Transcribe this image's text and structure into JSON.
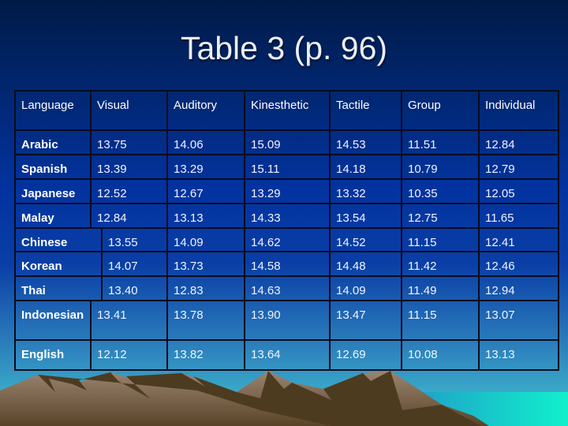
{
  "title": "Table 3 (p. 96)",
  "table": {
    "headers": [
      "Language",
      "Visual",
      "Auditory",
      "Kinesthetic",
      "Tactile",
      "Group",
      "Individual"
    ],
    "rows": [
      [
        "Arabic",
        "13.75",
        "14.06",
        "15.09",
        "14.53",
        "11.51",
        "12.84"
      ],
      [
        "Spanish",
        "13.39",
        "13.29",
        "15.11",
        "14.18",
        "10.79",
        "12.79"
      ],
      [
        "Japanese",
        "12.52",
        "12.67",
        "13.29",
        "13.32",
        "10.35",
        "12.05"
      ],
      [
        "Malay",
        "12.84",
        "13.13",
        "14.33",
        "13.54",
        "12.75",
        "11.65"
      ],
      [
        "Chinese",
        "13.55",
        "14.09",
        "14.62",
        "14.52",
        "11.15",
        "12.41"
      ],
      [
        "Korean",
        "14.07",
        "13.73",
        "14.58",
        "14.48",
        "11.42",
        "12.46"
      ],
      [
        "Thai",
        "13.40",
        "12.83",
        "14.63",
        "14.09",
        "11.49",
        "12.94"
      ],
      [
        "Indonesian",
        "13.41",
        "13.78",
        "13.90",
        "13.47",
        "11.15",
        "13.07"
      ],
      [
        "English",
        "12.12",
        "13.82",
        "13.64",
        "12.69",
        "10.08",
        "13.13"
      ]
    ]
  },
  "colors": {
    "mountain_light": "#8c7560",
    "mountain_dark": "#4a3a22",
    "sea": "#10e6c8"
  }
}
